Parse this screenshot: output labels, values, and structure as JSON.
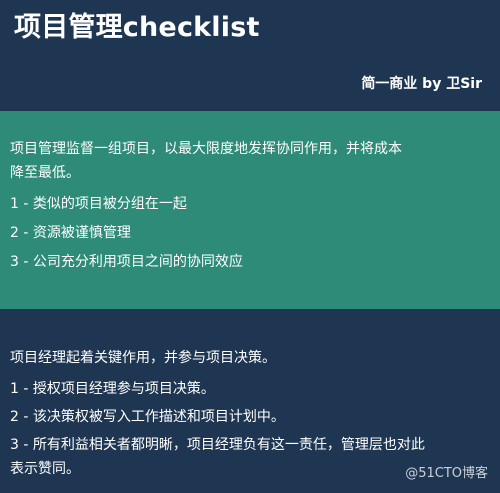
{
  "header": {
    "title": "项目管理checklist",
    "byline": "简一商业 by 卫Sir"
  },
  "teal_section": {
    "lines": [
      "项目管理监督一组项目，以最大限度地发挥协同作用，并将成本",
      "降至最低。",
      "1 - 类似的项目被分组在一起",
      "2 - 资源被谨慎管理",
      "3 - 公司充分利用项目之间的协同效应"
    ]
  },
  "navy_section": {
    "lines": [
      "项目经理起着关键作用，并参与项目决策。",
      "1 - 授权项目经理参与项目决策。",
      "2 - 该决策权被写入工作描述和项目计划中。",
      "3 - 所有利益相关者都明晰，项目经理负有这一责任，管理层也对此",
      "表示赞同。"
    ]
  },
  "watermark": "@51CTO博客",
  "colors": {
    "navy_bg": "#1f3653",
    "teal_bg": "#2e8b78",
    "text": "#ffffff"
  }
}
